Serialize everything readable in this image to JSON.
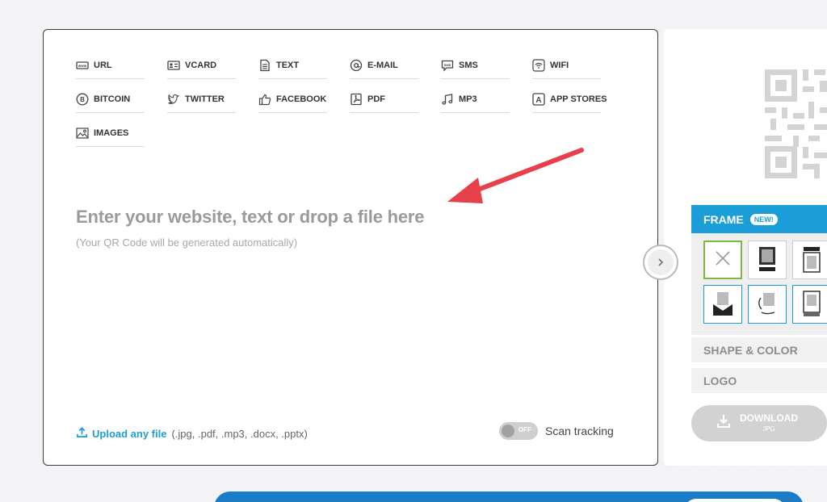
{
  "qr_types": [
    {
      "label": "URL",
      "icon": "www-icon"
    },
    {
      "label": "VCARD",
      "icon": "vcard-icon"
    },
    {
      "label": "TEXT",
      "icon": "text-document-icon"
    },
    {
      "label": "E-MAIL",
      "icon": "at-sign-icon"
    },
    {
      "label": "SMS",
      "icon": "sms-icon"
    },
    {
      "label": "WIFI",
      "icon": "wifi-icon"
    },
    {
      "label": "BITCOIN",
      "icon": "bitcoin-icon"
    },
    {
      "label": "TWITTER",
      "icon": "twitter-bird-icon"
    },
    {
      "label": "FACEBOOK",
      "icon": "thumbs-up-icon"
    },
    {
      "label": "PDF",
      "icon": "pdf-icon"
    },
    {
      "label": "MP3",
      "icon": "music-note-icon"
    },
    {
      "label": "APP STORES",
      "icon": "app-store-icon"
    },
    {
      "label": "IMAGES",
      "icon": "image-icon"
    }
  ],
  "input": {
    "title": "Enter your website, text or drop a file here",
    "subtitle": "(Your QR Code will be generated automatically)"
  },
  "upload": {
    "link_label": "Upload any file",
    "file_types": "(.jpg, .pdf, .mp3, .docx, .pptx)"
  },
  "tracking": {
    "toggle_state": "OFF",
    "label": "Scan tracking"
  },
  "panel": {
    "frame_label": "FRAME",
    "frame_badge": "NEW!",
    "shape_color_label": "SHAPE & COLOR",
    "logo_label": "LOGO",
    "download_label": "DOWNLOAD",
    "download_format": "JPG"
  },
  "colors": {
    "accent": "#1b9ed8",
    "annotation_arrow": "#e8404a",
    "frame_selected": "#7cb83c"
  }
}
